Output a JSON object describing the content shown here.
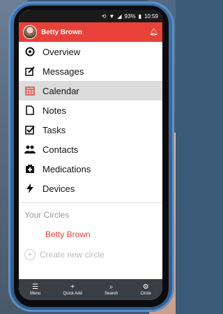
{
  "status": {
    "battery": "93%",
    "time": "10:59"
  },
  "header": {
    "user_name": "Betty Brown"
  },
  "menu": [
    {
      "label": "Overview",
      "icon": "overview-icon"
    },
    {
      "label": "Messages",
      "icon": "messages-icon"
    },
    {
      "label": "Calendar",
      "icon": "calendar-icon",
      "active": true
    },
    {
      "label": "Notes",
      "icon": "notes-icon"
    },
    {
      "label": "Tasks",
      "icon": "tasks-icon"
    },
    {
      "label": "Contacts",
      "icon": "contacts-icon"
    },
    {
      "label": "Medications",
      "icon": "medications-icon"
    },
    {
      "label": "Devices",
      "icon": "devices-icon"
    }
  ],
  "circles": {
    "title": "Your Circles",
    "items": [
      "Betty Brown"
    ],
    "create_label": "Create new circle"
  },
  "bottom_nav": [
    {
      "label": "Menu",
      "icon": "menu-icon"
    },
    {
      "label": "Quick Add",
      "icon": "plus-icon"
    },
    {
      "label": "Search",
      "icon": "search-icon"
    },
    {
      "label": "Circle",
      "icon": "gear-icon"
    }
  ],
  "colors": {
    "accent": "#e8413a",
    "nav_bg": "#3a3f45"
  }
}
